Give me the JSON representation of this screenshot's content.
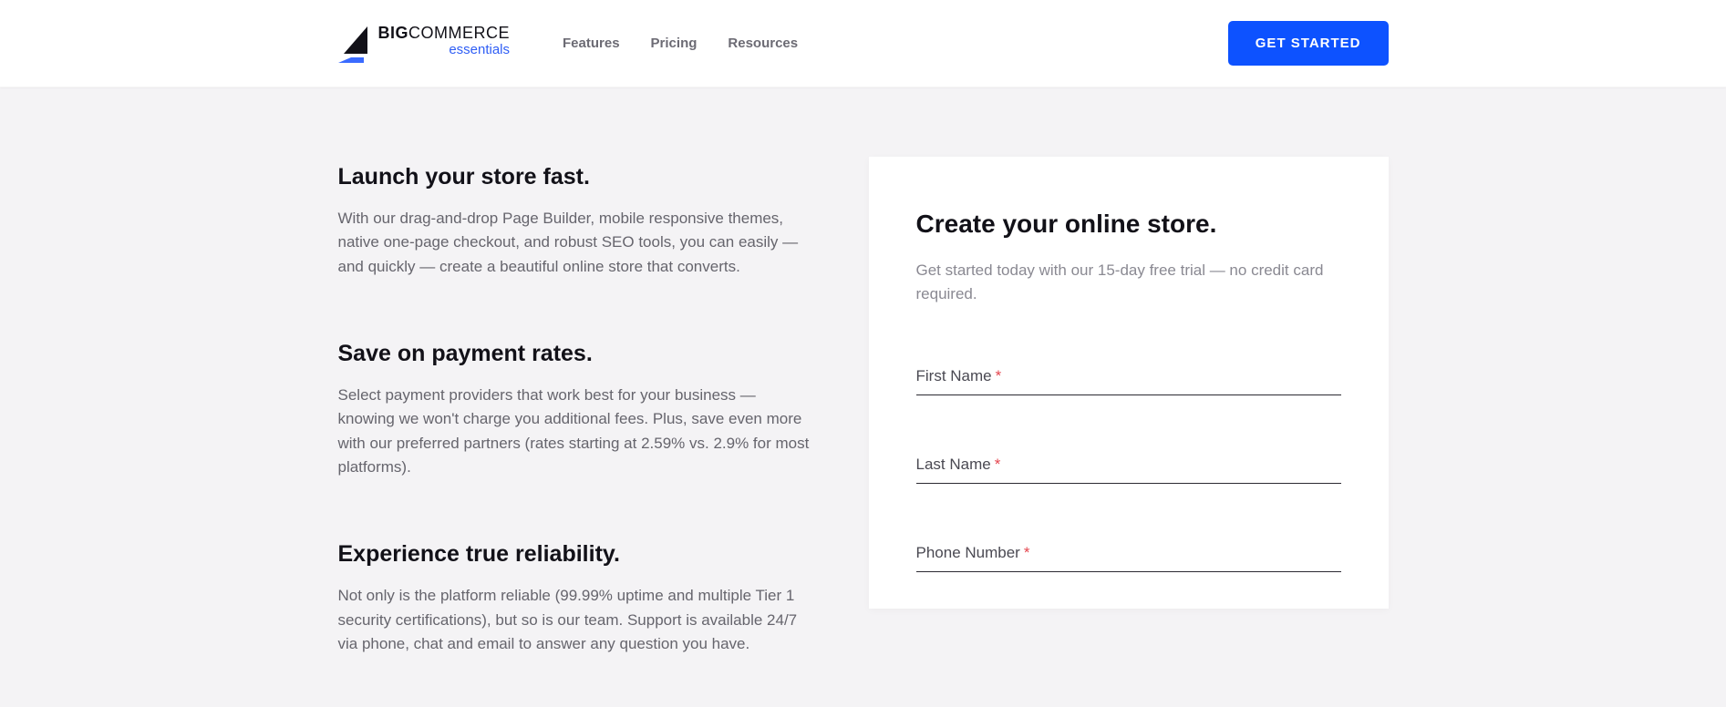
{
  "header": {
    "logo": {
      "big": "BIG",
      "commerce": "COMMERCE",
      "essentials": "essentials"
    },
    "nav": {
      "features": "Features",
      "pricing": "Pricing",
      "resources": "Resources"
    },
    "cta": "GET STARTED"
  },
  "features": [
    {
      "title": "Launch your store fast.",
      "desc": "With our drag-and-drop Page Builder, mobile responsive themes, native one-page checkout, and robust SEO tools, you can easily — and quickly — create a beautiful online store that converts."
    },
    {
      "title": "Save on payment rates.",
      "desc": "Select payment providers that work best for your business — knowing we won't charge you additional fees. Plus, save even more with our preferred partners (rates starting at 2.59% vs. 2.9% for most platforms)."
    },
    {
      "title": "Experience true reliability.",
      "desc": "Not only is the platform reliable (99.99% uptime and multiple Tier 1 security certifications), but so is our team. Support is available 24/7 via phone, chat and email to answer any question you have."
    }
  ],
  "form": {
    "title": "Create your online store.",
    "sub": "Get started today with our 15-day free trial — no credit card required.",
    "fields": {
      "first_name": "First Name",
      "last_name": "Last Name",
      "phone": "Phone Number"
    },
    "required_marker": "*"
  }
}
